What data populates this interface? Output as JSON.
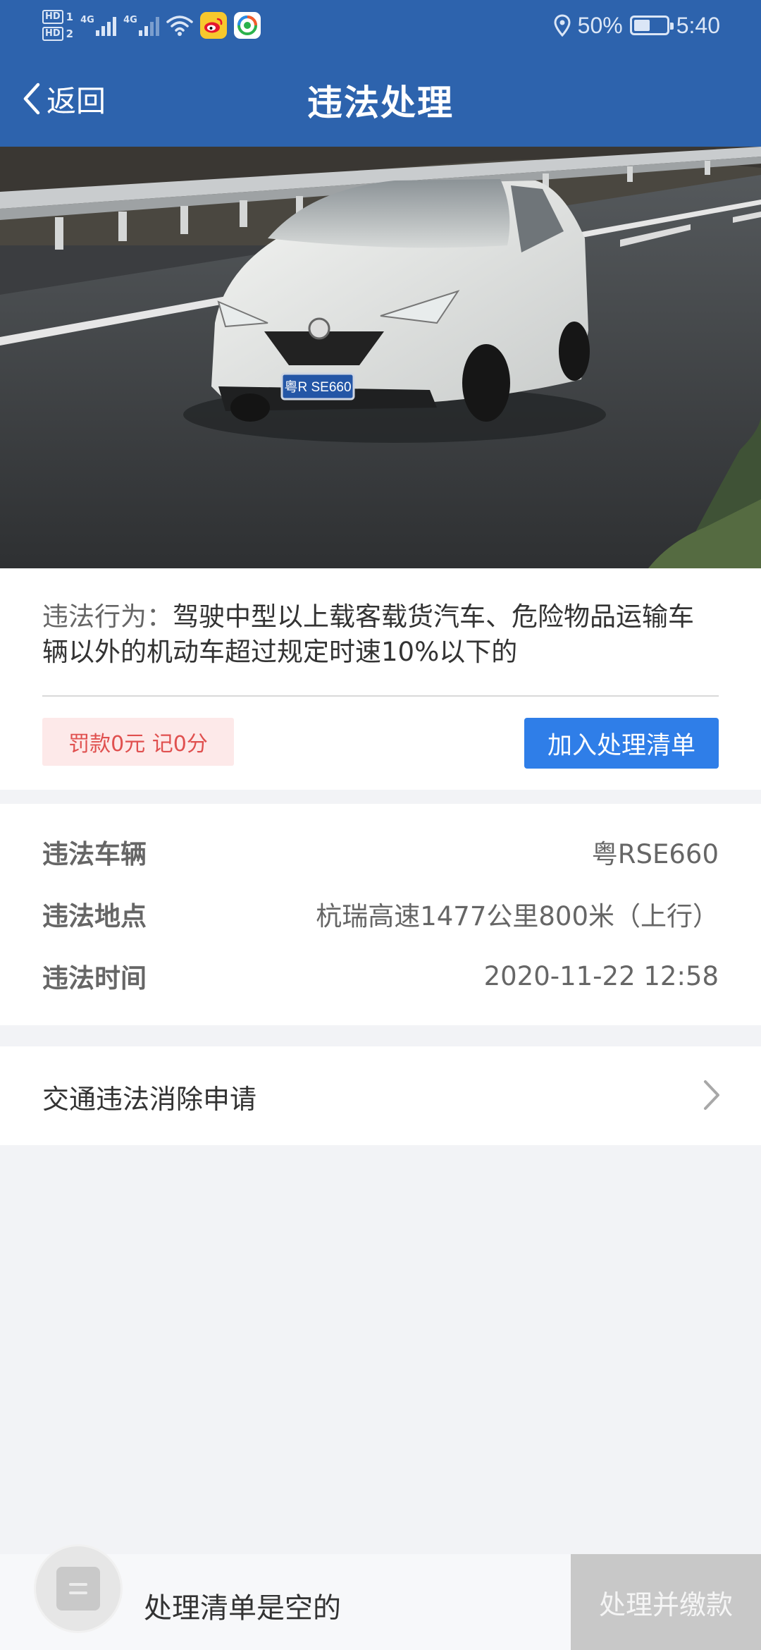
{
  "status_bar": {
    "hd1": "HD",
    "hd1_sub": "1",
    "hd2": "HD",
    "hd2_sub": "2",
    "sim1_net": "4G",
    "sim2_net": "4G",
    "battery_percent_text": "50%",
    "battery_level": 0.5,
    "time": "5:40",
    "icons": [
      "signal-icon",
      "wifi-icon",
      "weibo-app-icon",
      "app-notification-icon",
      "location-icon",
      "battery-icon"
    ]
  },
  "header": {
    "back_label": "返回",
    "title": "违法处理"
  },
  "photo": {
    "plate_text": "粤R SE660"
  },
  "violation": {
    "behavior_label": "违法行为：",
    "behavior_text": "驾驶中型以上载客载货汽车、危险物品运输车辆以外的机动车超过规定时速10%以下的",
    "penalty_text": "罚款0元 记0分",
    "add_button_label": "加入处理清单"
  },
  "details": [
    {
      "label": "违法车辆",
      "value": "粤RSE660"
    },
    {
      "label": "违法地点",
      "value": "杭瑞高速1477公里800米（上行）"
    },
    {
      "label": "违法时间",
      "value": "2020-11-22 12:58"
    }
  ],
  "appeal": {
    "label": "交通违法消除申请"
  },
  "bottom": {
    "empty_text": "处理清单是空的",
    "pay_button_label": "处理并缴款"
  },
  "colors": {
    "brand": "#2d63ad",
    "primary_button": "#2f7ee8",
    "penalty_text": "#e0504f",
    "penalty_bg": "#fde9e9",
    "disabled_button": "#c8c8c8"
  }
}
